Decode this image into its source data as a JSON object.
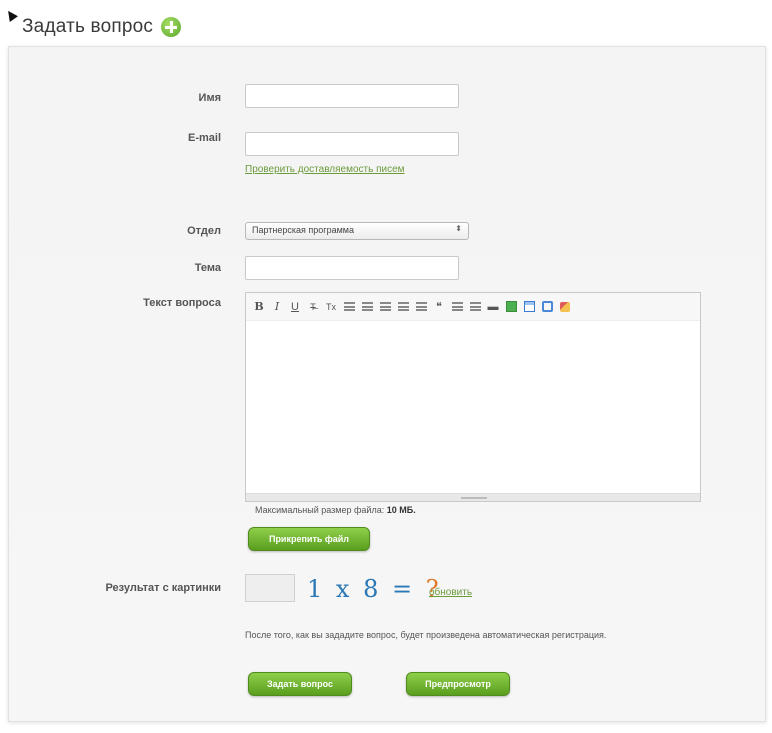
{
  "page": {
    "title": "Задать вопрос"
  },
  "icons": {
    "add": "plus-circle-icon"
  },
  "colors": {
    "accent": "#6fb93a",
    "link": "#6c9b3c",
    "captcha": "#2a78b6"
  },
  "form": {
    "name": {
      "label": "Имя",
      "value": ""
    },
    "email": {
      "label": "E-mail",
      "value": "",
      "check_link": "Проверить доставляемость писем"
    },
    "department": {
      "label": "Отдел",
      "selected": "Партнерская программа"
    },
    "subject": {
      "label": "Тема",
      "value": ""
    },
    "question": {
      "label": "Текст вопроса",
      "toolbar": [
        "B",
        "I",
        "U",
        "T̶",
        "Tx",
        "align-left",
        "align-center",
        "align-right",
        "indent",
        "outdent",
        "quote",
        "list-ordered",
        "list-bulleted",
        "hr",
        "image",
        "table",
        "fullscreen",
        "clear-format"
      ],
      "value": ""
    },
    "file": {
      "note_prefix": "Максимальный размер файла:",
      "note_size": "10 МБ.",
      "attach_button": "Прикрепить файл"
    },
    "captcha": {
      "label": "Результат с картинки",
      "expression": "1 x 8 =",
      "question_mark": "?",
      "refresh_link": "обновить",
      "value": ""
    },
    "registration_note": "После того, как вы зададите вопрос, будет произведена автоматическая регистрация.",
    "submit_button": "Задать вопрос",
    "preview_button": "Предпросмотр"
  }
}
